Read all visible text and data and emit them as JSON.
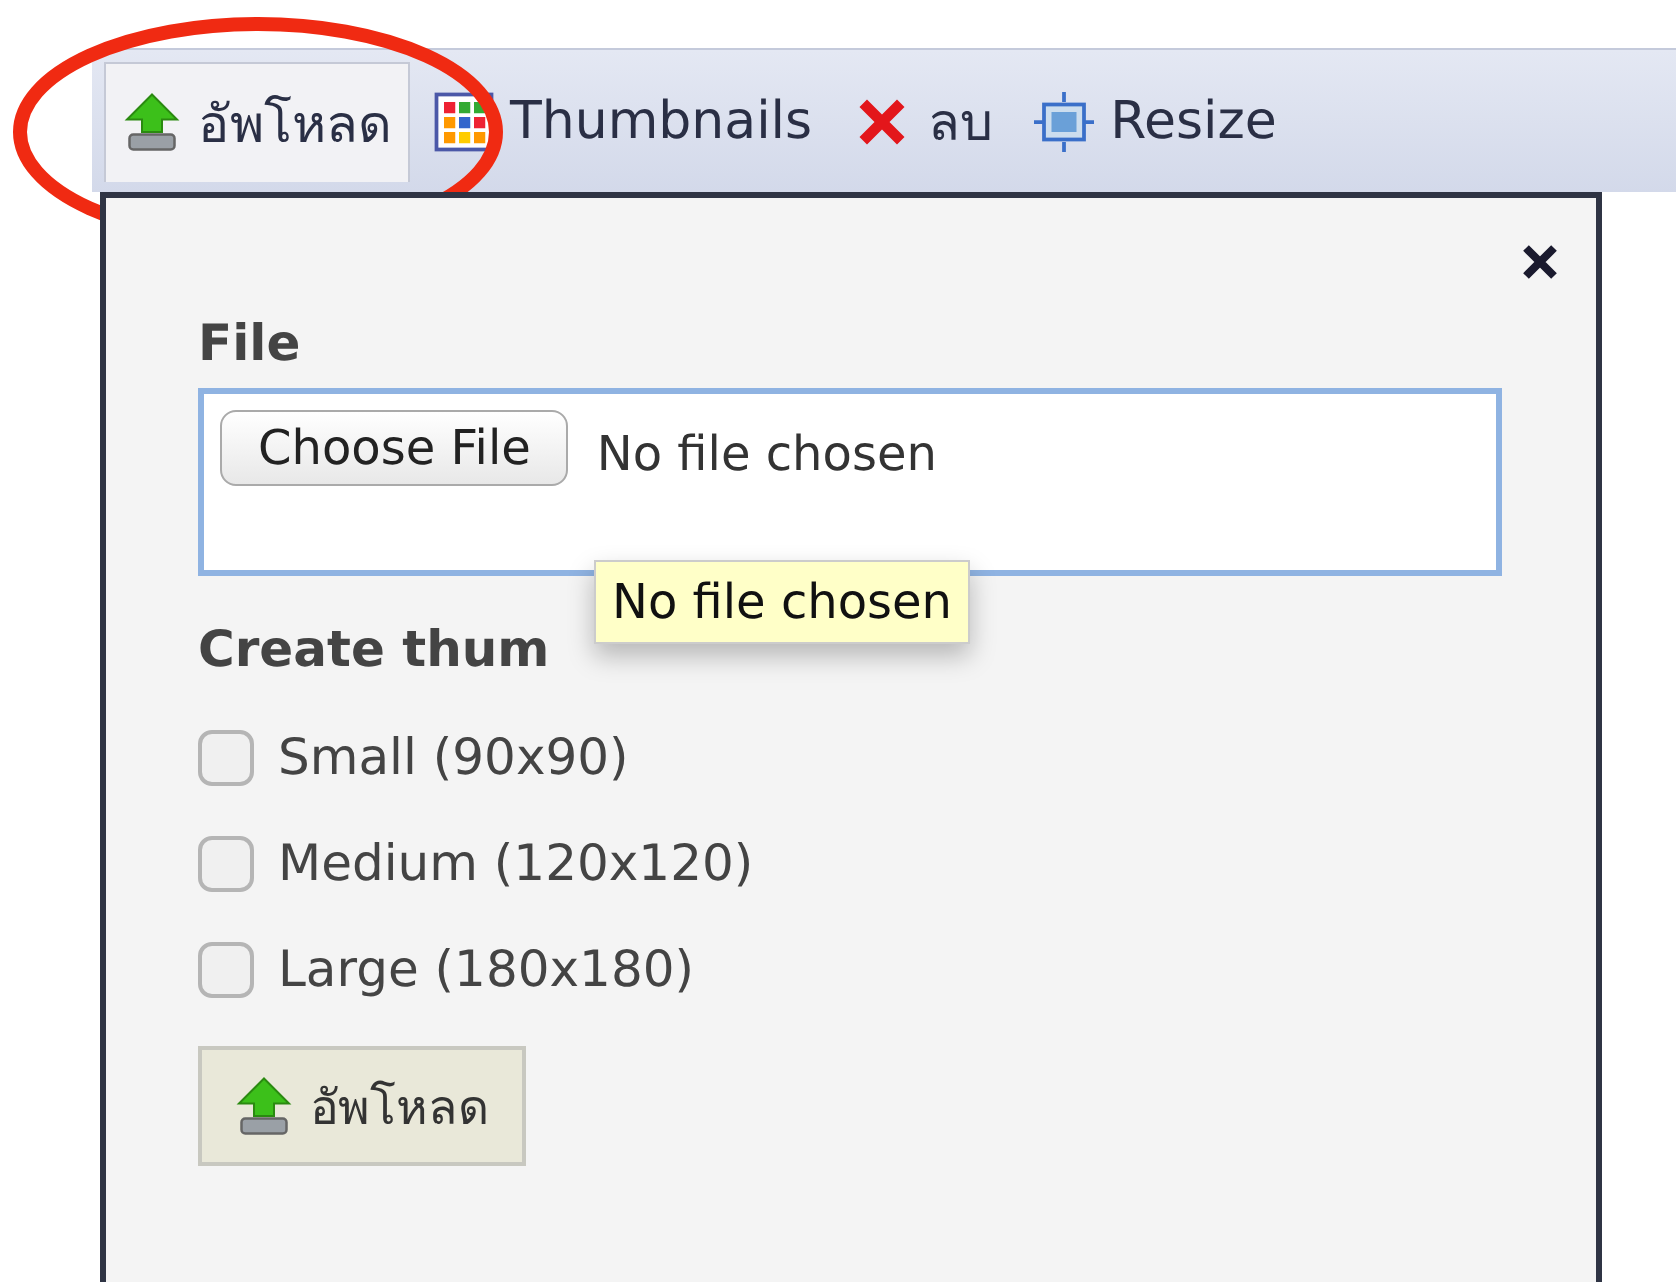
{
  "toolbar": {
    "items": [
      {
        "kind": "upload",
        "label": "อัพโหลด",
        "selected": true
      },
      {
        "kind": "thumbnails",
        "label": "Thumbnails",
        "selected": false
      },
      {
        "kind": "delete",
        "label": "ลบ",
        "selected": false
      },
      {
        "kind": "resize",
        "label": "Resize",
        "selected": false
      }
    ]
  },
  "upload_panel": {
    "file_label": "File",
    "choose_button": "Choose File",
    "file_status": "No file chosen",
    "tooltip": "No file chosen",
    "thumbnails_heading": "Create thum",
    "options": [
      {
        "label": "Small (90x90)",
        "checked": false
      },
      {
        "label": "Medium (120x120)",
        "checked": false
      },
      {
        "label": "Large (180x180)",
        "checked": false
      }
    ],
    "submit_button": "อัพโหลด"
  }
}
